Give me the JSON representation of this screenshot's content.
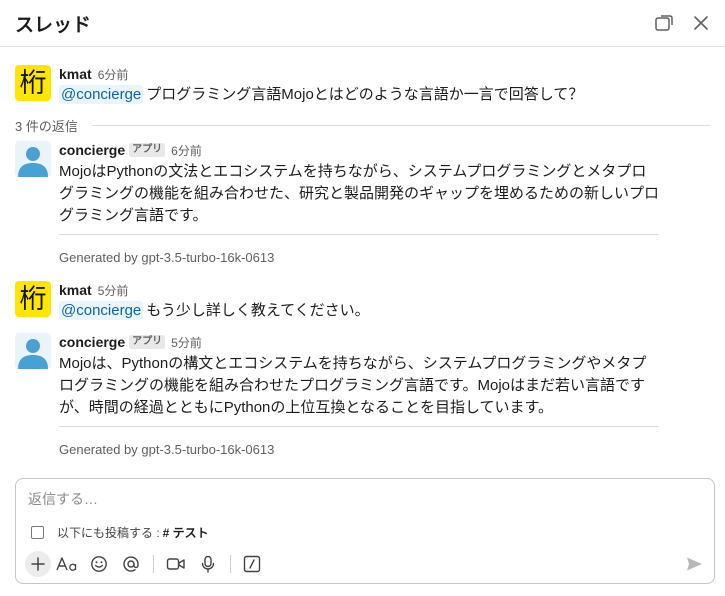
{
  "header": {
    "title": "スレッド"
  },
  "replies_label": "3 件の返信",
  "messages": [
    {
      "author": "kmat",
      "avatar_char": "桁",
      "time": "6分前",
      "mention": "@concierge",
      "text": "プログラミング言語Mojoとはどのような言語か一言で回答して？"
    },
    {
      "author": "concierge",
      "badge": "アプリ",
      "time": "6分前",
      "lines": [
        "MojoはPythonの文法とエコシステムを持ちながら、システムプログラミングとメタプロ",
        "グラミングの機能を組み合わせた、研究と製品開発のギャップを埋めるための新しいプロ",
        "グラミング言語です。"
      ],
      "generated": "Generated by gpt-3.5-turbo-16k-0613"
    },
    {
      "author": "kmat",
      "avatar_char": "桁",
      "time": "5分前",
      "mention": "@concierge",
      "text": "もう少し詳しく教えてください。"
    },
    {
      "author": "concierge",
      "badge": "アプリ",
      "time": "5分前",
      "lines": [
        "Mojoは、Pythonの構文とエコシステムを持ちながら、システムプログラミングやメタプ",
        "ログラミングの機能を組み合わせたプログラミング言語です。Mojoはまだ若い言語です",
        "が、時間の経過とともにPythonの上位互換となることを目指しています。"
      ],
      "generated": "Generated by gpt-3.5-turbo-16k-0613"
    }
  ],
  "composer": {
    "placeholder": "返信する…",
    "also_send_label": "以下にも投稿する :",
    "channel_name": "# テスト"
  },
  "icons": {
    "header": [
      "popout-icon",
      "close-icon"
    ],
    "toolbar": [
      "plus-icon",
      "text-format-icon",
      "emoji-icon",
      "mention-icon",
      "video-icon",
      "microphone-icon",
      "slash-command-icon",
      "send-icon"
    ]
  },
  "colors": {
    "mention_bg": "#e8f5fa",
    "mention_text": "#1264a3",
    "kmat_avatar": "#ffe600",
    "bot_avatar": "#4a9fd4"
  }
}
